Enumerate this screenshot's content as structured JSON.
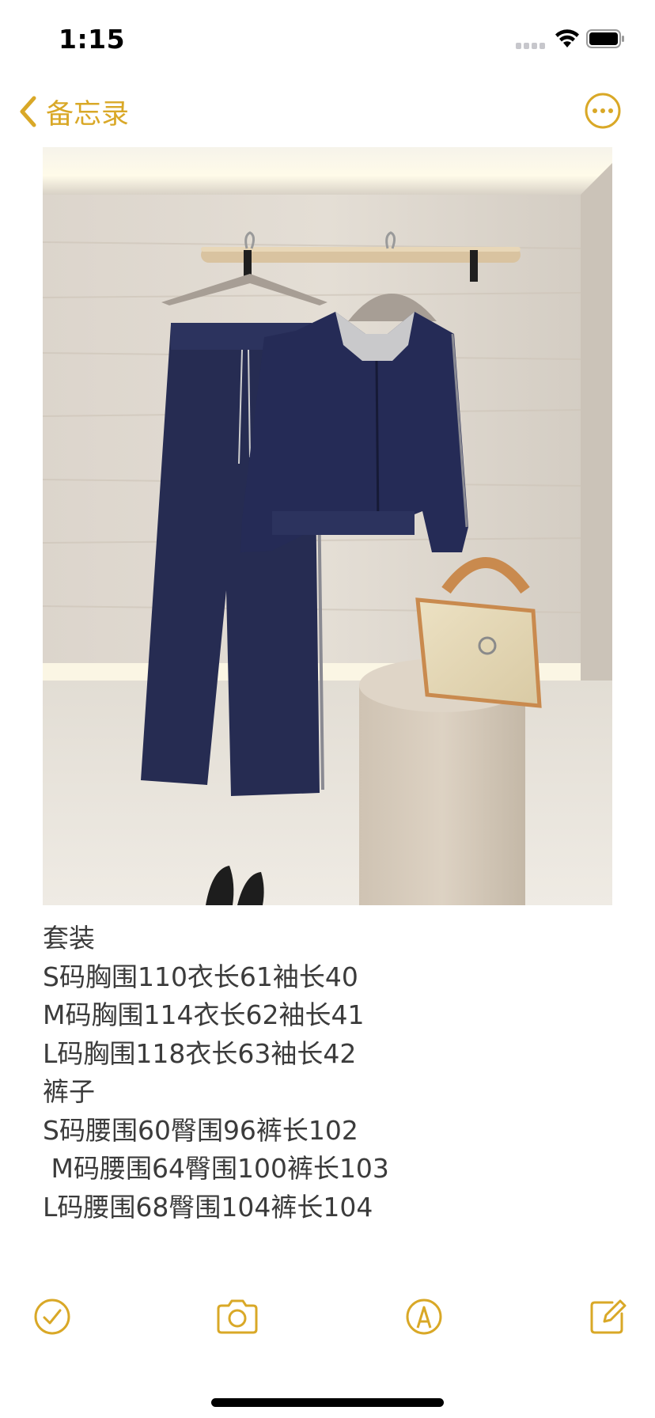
{
  "status_bar": {
    "time": "1:15"
  },
  "nav": {
    "back_label": "备忘录",
    "accent_color": "#d9a827"
  },
  "photo": {
    "subject": "navy hooded zip jacket and wide-leg pants on hangers, beige tote bag on pedestal"
  },
  "note": {
    "lines": [
      "套装",
      "S码胸围110衣长61袖长40",
      "M码胸围114衣长62袖长41",
      "L码胸围118衣长63袖长42",
      "裤子",
      "S码腰围60臀围96裤长102",
      " M码腰围64臀围100裤长103",
      "L码腰围68臀围104裤长104"
    ]
  },
  "icons": {
    "back": "chevron-left-icon",
    "more": "ellipsis-circle-icon",
    "checklist": "checkmark-circle-icon",
    "camera": "camera-icon",
    "markup": "pen-circle-icon",
    "compose": "compose-icon"
  }
}
